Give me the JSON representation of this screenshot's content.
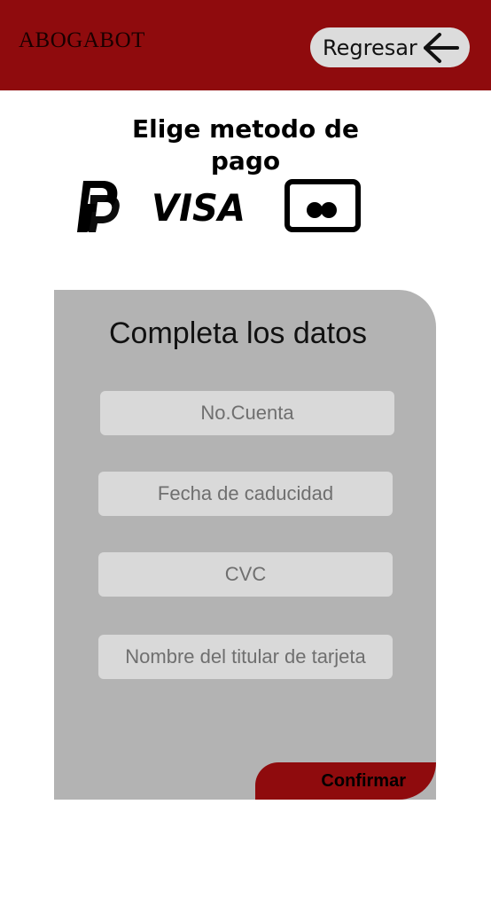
{
  "header": {
    "brand": "ABOGABOT",
    "back_label": "Regresar",
    "back_icon": "arrow-left-icon"
  },
  "payment": {
    "title": "Elige metodo de pago",
    "methods": [
      {
        "name": "PayPal",
        "icon": "paypal-icon"
      },
      {
        "name": "VISA",
        "icon": "visa-icon"
      },
      {
        "name": "Card",
        "icon": "card-icon"
      }
    ]
  },
  "form": {
    "title": "Completa los datos",
    "fields": {
      "account": {
        "placeholder": "No.Cuenta",
        "value": ""
      },
      "expiry": {
        "placeholder": "Fecha de caducidad",
        "value": ""
      },
      "cvc": {
        "placeholder": "CVC",
        "value": ""
      },
      "holder": {
        "placeholder": "Nombre del titular de tarjeta",
        "value": ""
      }
    },
    "confirm_label": "Confirmar"
  },
  "colors": {
    "brand_red": "#8f0b0d",
    "panel_gray": "#b3b3b3",
    "field_gray": "#d9d9d9"
  }
}
